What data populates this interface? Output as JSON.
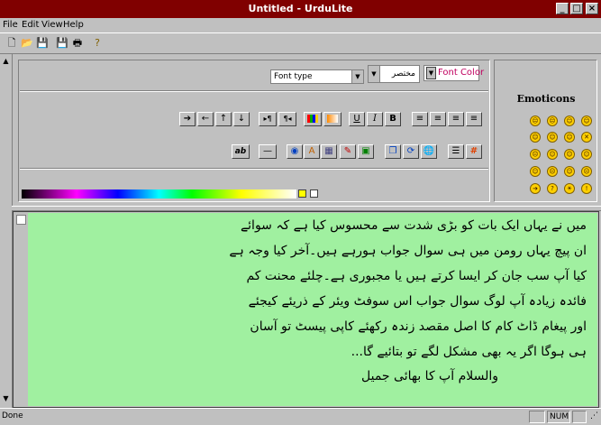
{
  "window": {
    "title": "Untitled - UrduLite"
  },
  "menu": [
    "File",
    "Edit",
    "View",
    "Help"
  ],
  "toolbar_icons": [
    "new-file-icon",
    "open-folder-icon",
    "save-icon",
    "save-as-icon",
    "print-icon",
    "help-icon"
  ],
  "format": {
    "font_type_placeholder": "Font type",
    "font_size_value": "مختصر",
    "font_color_label": "Font Color"
  },
  "emoticons": {
    "title": "Emoticons"
  },
  "editor": {
    "lines": [
      "میں نے یہاں ایک بات کو بڑی شدت سے محسوس کیا ہے کہ سوائے",
      "ان پیچ یہاں رومن میں ہی سوال جواب ہورہے ہیں۔آخر کیا وجہ ہے",
      "کیا آپ سب جان کر ایسا کرتے ہیں یا مجبوری ہے۔چلئے محنت کم",
      "فائدہ زیادہ آپ لوگ سوال جواب اس سوفٹ ویئر کے ذریئے کیجئے",
      "اور پیغام ڈاٹ کام کا اصل مقصد زندہ رکھئے کاپی پیسٹ تو آسان",
      "ہی ہوگا اگر یہ بھی مشکل لگے تو بتائیے گا...",
      "والسلام آپ کا بھائی جمیل"
    ]
  },
  "status": {
    "left": "Done",
    "num": "NUM"
  }
}
